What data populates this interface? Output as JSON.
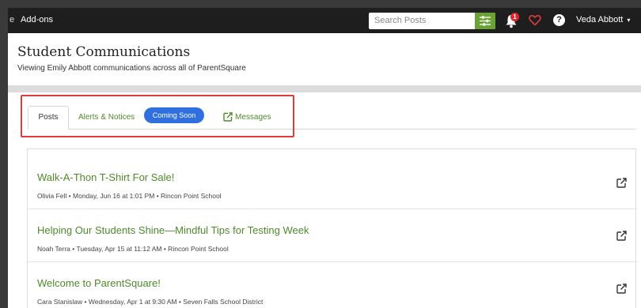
{
  "topbar": {
    "partial_menu": "e",
    "addons_label": "Add-ons",
    "search_placeholder": "Search Posts",
    "notification_count": "1",
    "help_label": "?",
    "user_name": "Veda Abbott",
    "user_caret": "▾"
  },
  "page": {
    "title": "Student Communications",
    "subtitle": "Viewing Emily Abbott communications across all of ParentSquare"
  },
  "tabs": {
    "posts": "Posts",
    "alerts": "Alerts & Notices",
    "coming_soon": "Coming Soon",
    "messages": "Messages"
  },
  "posts": [
    {
      "title": "Walk-A-Thon T-Shirt For Sale!",
      "meta": "Olivia Fell • Monday, Jun 16 at 1:01 PM • Rincon Point School"
    },
    {
      "title": "Helping Our Students Shine—Mindful Tips for Testing Week",
      "meta": "Noah Terra • Tuesday, Apr 15 at 11:12 AM • Rincon Point School"
    },
    {
      "title": "Welcome to ParentSquare!",
      "meta": "Cara Stanislaw • Wednesday, Apr 1 at 9:30 AM • Seven Falls School District"
    }
  ],
  "colors": {
    "topbar_bg": "#1e1e1e",
    "link_green": "#4f8a2b",
    "filter_green": "#6aa236",
    "badge_blue": "#2f6fe0",
    "highlight_red": "#e03a3a",
    "notification_red": "#e0262f"
  },
  "icons": {
    "filter": "sliders-icon",
    "bell": "bell-icon",
    "heart": "heart-icon",
    "help": "help-icon",
    "external": "external-link-icon",
    "messages": "edit-square-icon"
  }
}
